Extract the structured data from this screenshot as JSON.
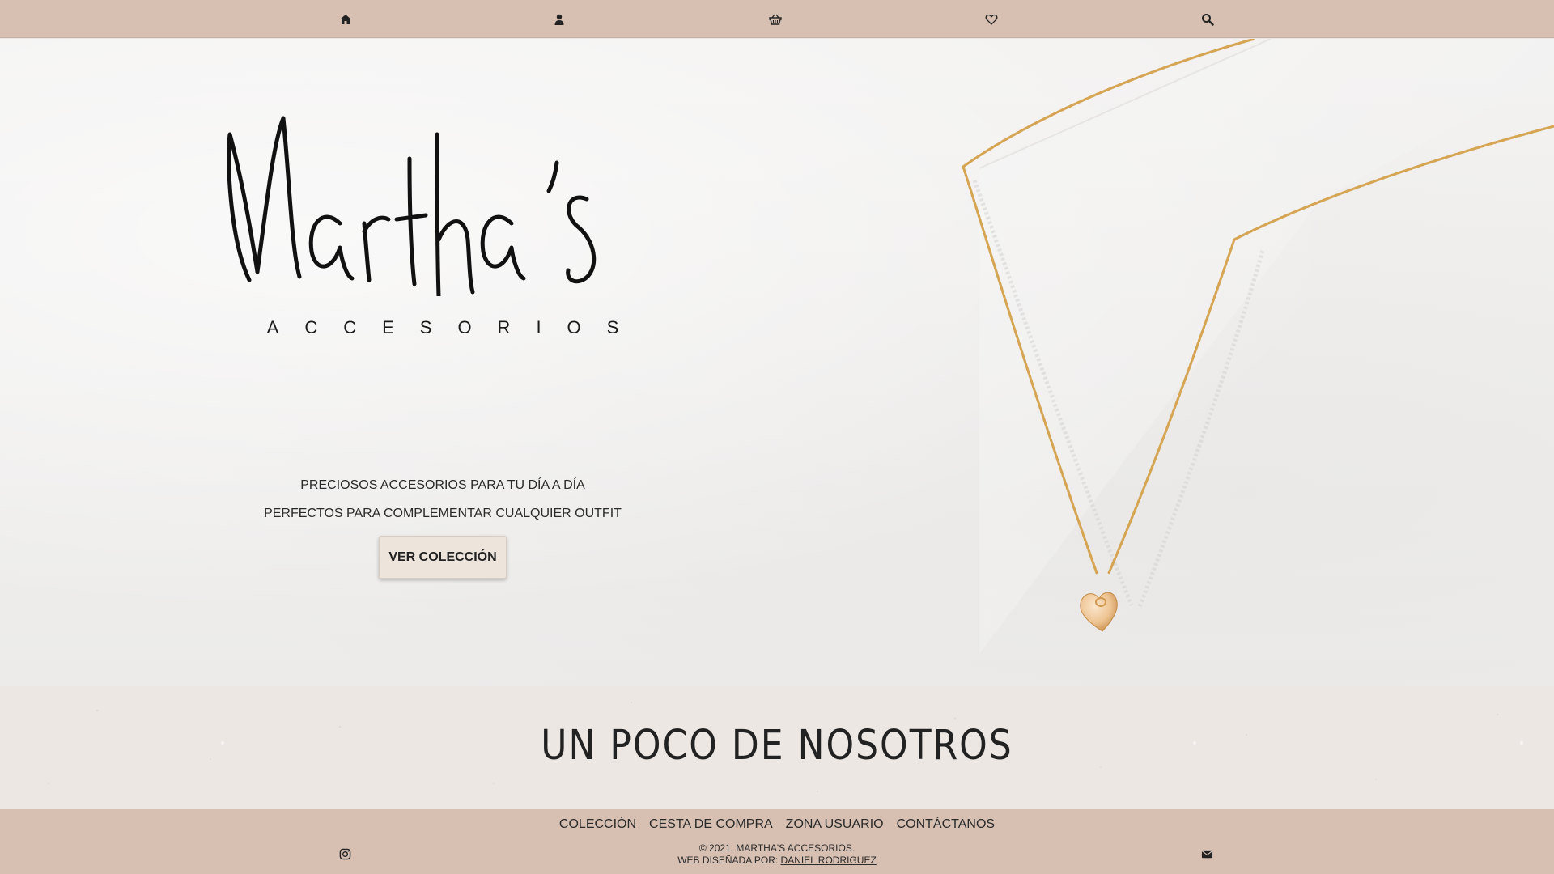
{
  "topnav": {
    "icons": [
      "home-icon",
      "user-icon",
      "basket-icon",
      "heart-icon",
      "search-icon"
    ]
  },
  "hero": {
    "logo_name": "Martha's",
    "logo_subtitle": "ACCESORIOS",
    "tagline_1": "PRECIOSOS ACCESORIOS PARA TU DÍA A DÍA",
    "tagline_2": "PERFECTOS PARA COMPLEMENTAR CUALQUIER OUTFIT",
    "cta_label": "VER COLECCIÓN"
  },
  "about": {
    "title": "UN POCO DE NOSOTROS"
  },
  "footer": {
    "links": [
      "COLECCIÓN",
      "CESTA DE COMPRA",
      "ZONA USUARIO",
      "CONTÁCTANOS"
    ],
    "copyright": "© 2021, MARTHA'S ACCESORIOS.",
    "designed_by_prefix": "WEB DISEÑADA POR: ",
    "designer": "DANIEL RODRIGUEZ",
    "left_icon": "instagram-icon",
    "right_icon": "envelope-icon"
  },
  "colors": {
    "nav_bg": "#d7c0b2",
    "hero_bg": "#f0efee",
    "button_bg": "#ede4dc",
    "chain_gold": "#d4a24c"
  }
}
